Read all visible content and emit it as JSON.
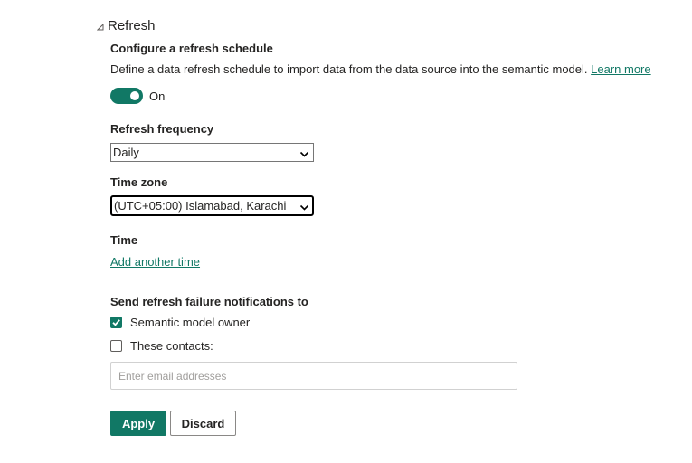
{
  "section": {
    "title": "Refresh",
    "caret_icon": "caret-expanded-icon"
  },
  "schedule": {
    "heading": "Configure a refresh schedule",
    "description": "Define a data refresh schedule to import data from the data source into the semantic model.",
    "learn_more": "Learn more",
    "toggle_state": "on",
    "toggle_label": "On"
  },
  "frequency": {
    "label": "Refresh frequency",
    "selected": "Daily"
  },
  "timezone": {
    "label": "Time zone",
    "selected": "(UTC+05:00) Islamabad, Karachi"
  },
  "time": {
    "label": "Time",
    "add_link": "Add another time"
  },
  "notifications": {
    "label": "Send refresh failure notifications to",
    "owner_label": "Semantic model owner",
    "owner_checked": true,
    "contacts_label": "These contacts:",
    "contacts_checked": false,
    "email_placeholder": "Enter email addresses",
    "email_value": ""
  },
  "actions": {
    "apply_label": "Apply",
    "discard_label": "Discard"
  },
  "colors": {
    "accent": "#117865",
    "text": "#252423",
    "link": "#117865"
  }
}
